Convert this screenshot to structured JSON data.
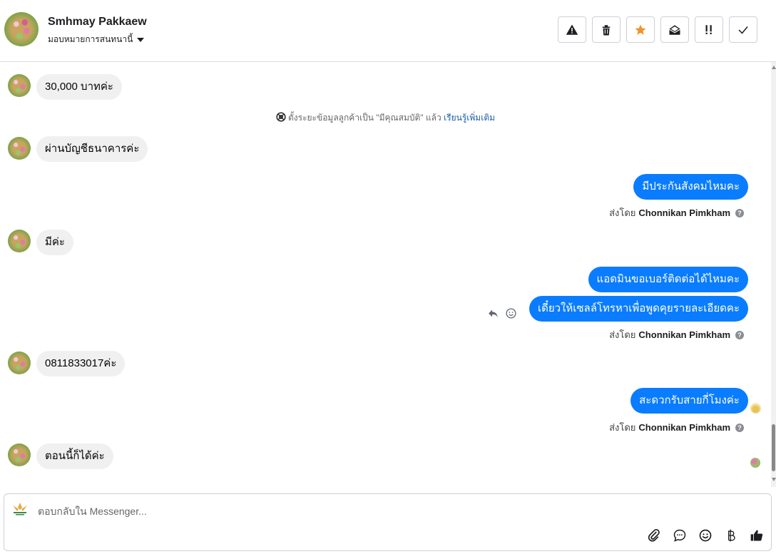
{
  "header": {
    "name": "Smhmay Pakkaew",
    "assign_label": "มอบหมายการสนทนานี้"
  },
  "actions": [
    {
      "icon": "warning-icon"
    },
    {
      "icon": "trash-icon"
    },
    {
      "icon": "star-icon",
      "color": "#f0932b"
    },
    {
      "icon": "open-envelope-icon"
    },
    {
      "icon": "important-icon"
    },
    {
      "icon": "check-icon"
    }
  ],
  "messages": {
    "m1": "30,000 บาทค่ะ",
    "system_text": "ตั้งระยะข้อมูลลูกค้าเป็น \"มีคุณสมบัติ\" แล้ว",
    "system_link": "เรียนรู้เพิ่มเติม",
    "m2": "ผ่านบัญชีธนาคารค่ะ",
    "m3": "มีประกันสังคมไหมคะ",
    "sent_by_prefix": "ส่งโดย",
    "sender": "Chonnikan Pimkham",
    "m4": "มีค่ะ",
    "m5": "แอดมินขอเบอร์ติดต่อได้ไหมคะ",
    "m6": "เดี๋ยวให้เซลล์โทรหาเพื่อพูดคุยรายละเอียดคะ",
    "m7": "0811833017ค่ะ",
    "m8": "สะดวกรับสายกี่โมงค่ะ",
    "m9": "ตอนนี้ก็ได้ค่ะ"
  },
  "composer": {
    "placeholder": "ตอบกลับใน Messenger...",
    "tools": [
      "attachment-icon",
      "comment-icon",
      "emoji-icon",
      "baht-icon",
      "like-icon"
    ]
  },
  "colors": {
    "outgoing_bubble": "#0a7cff",
    "incoming_bubble": "#f0f0f0",
    "link": "#1a5fa8"
  }
}
